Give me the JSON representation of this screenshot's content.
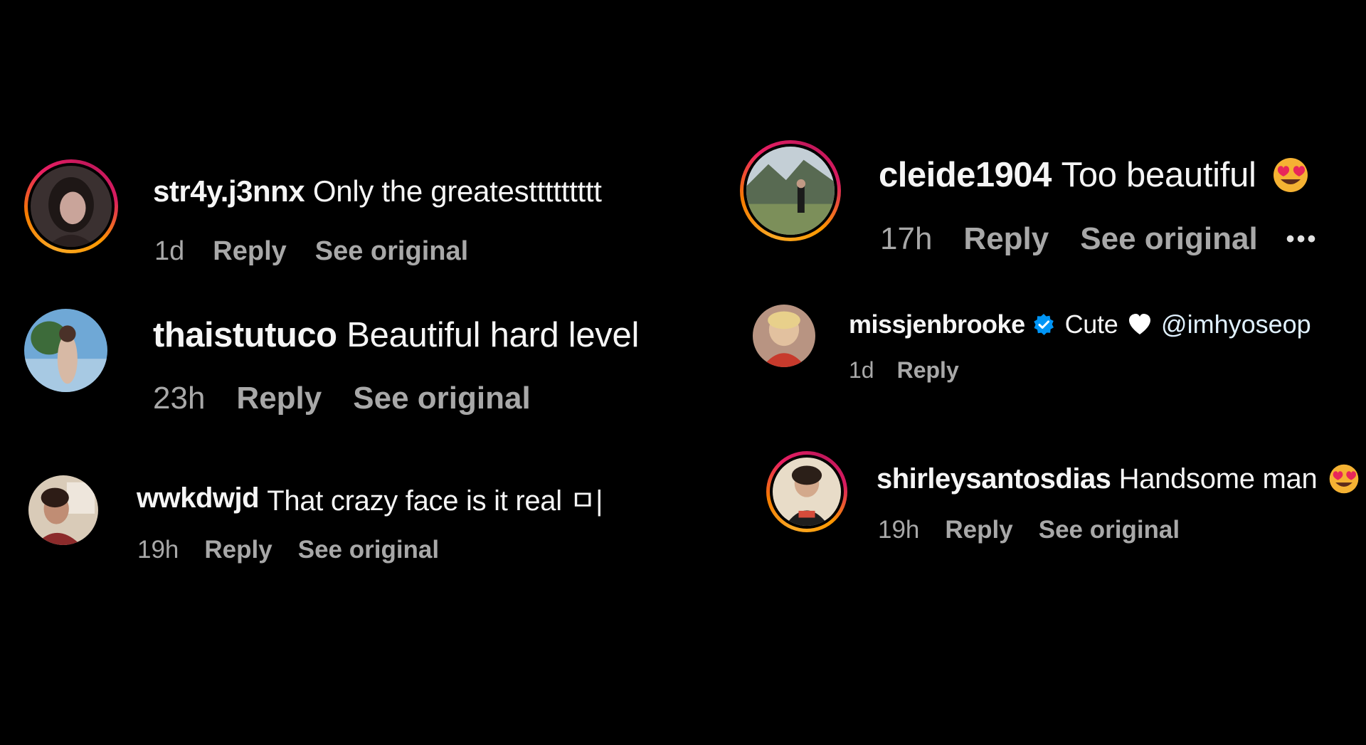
{
  "comments": [
    {
      "username": "str4y.j3nnx",
      "text": "Only the greatesttttttttt",
      "time": "1d",
      "reply_label": "Reply",
      "see_original_label": "See original"
    },
    {
      "username": "thaistutuco",
      "text": "Beautiful hard level",
      "time": "23h",
      "reply_label": "Reply",
      "see_original_label": "See original"
    },
    {
      "username": "wwkdwjd",
      "text": "That crazy face is it real ㅁ|",
      "time": "19h",
      "reply_label": "Reply",
      "see_original_label": "See original"
    },
    {
      "username": "cleide1904",
      "text": "Too beautiful",
      "emoji": "heart-eyes-emoji",
      "time": "17h",
      "reply_label": "Reply",
      "see_original_label": "See original",
      "more_label": "•••"
    },
    {
      "username": "missjenbrooke",
      "verified": true,
      "text": "Cute",
      "heart": "white-heart-emoji",
      "mention": "@imhyoseop",
      "time": "1d",
      "reply_label": "Reply"
    },
    {
      "username": "shirleysantosdias",
      "text": "Handsome man",
      "emoji": "heart-eyes-emoji",
      "time": "19h",
      "reply_label": "Reply",
      "see_original_label": "See original"
    }
  ],
  "colors": {
    "background": "#000000",
    "text": "#f5f5f5",
    "meta": "#a8a8a8",
    "verified": "#0095f6",
    "story_ring": "#e91e63"
  }
}
